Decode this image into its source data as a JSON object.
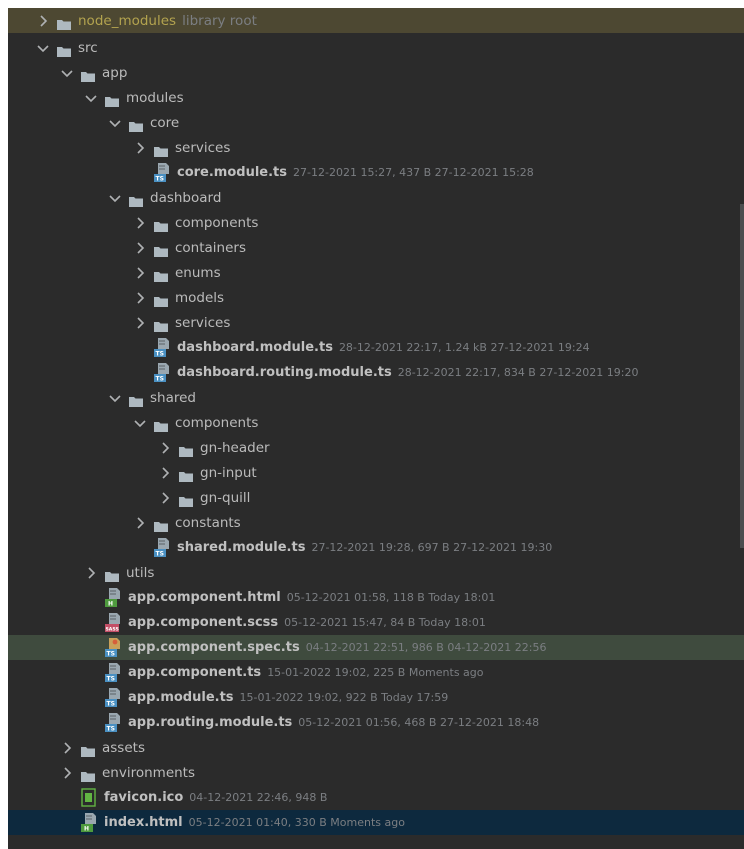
{
  "colors": {
    "background": "#2b2b2b",
    "folder": "#aeb9c0",
    "text": "#bbbbbb",
    "meta_text": "#7b7e82",
    "excluded_text": "#b3a34f",
    "ts_badge": "#4a90c2",
    "html_badge": "#4e9a3e",
    "sass_badge": "#c34e66",
    "selected_row": "#3f4b3e",
    "focused_row": "#0d293e",
    "library_row": "#4d4832"
  },
  "tree": {
    "items": [
      {
        "type": "folder",
        "state": "collapsed",
        "depth": 1,
        "name": "node_modules",
        "meta": "library root",
        "icon": "folder-icon",
        "highlight": "root",
        "style": "yellow"
      },
      {
        "type": "folder",
        "state": "expanded",
        "depth": 1,
        "name": "src",
        "icon": "folder-icon"
      },
      {
        "type": "folder",
        "state": "expanded",
        "depth": 2,
        "name": "app",
        "icon": "folder-icon"
      },
      {
        "type": "folder",
        "state": "expanded",
        "depth": 3,
        "name": "modules",
        "icon": "folder-icon"
      },
      {
        "type": "folder",
        "state": "expanded",
        "depth": 4,
        "name": "core",
        "icon": "folder-icon"
      },
      {
        "type": "folder",
        "state": "collapsed",
        "depth": 5,
        "name": "services",
        "icon": "folder-icon"
      },
      {
        "type": "file",
        "depth": 5,
        "name": "core.module.ts",
        "meta": "27-12-2021 15:27, 437 B 27-12-2021 15:28",
        "icon": "typescript-file-icon"
      },
      {
        "type": "folder",
        "state": "expanded",
        "depth": 4,
        "name": "dashboard",
        "icon": "folder-icon"
      },
      {
        "type": "folder",
        "state": "collapsed",
        "depth": 5,
        "name": "components",
        "icon": "folder-icon"
      },
      {
        "type": "folder",
        "state": "collapsed",
        "depth": 5,
        "name": "containers",
        "icon": "folder-icon"
      },
      {
        "type": "folder",
        "state": "collapsed",
        "depth": 5,
        "name": "enums",
        "icon": "folder-icon"
      },
      {
        "type": "folder",
        "state": "collapsed",
        "depth": 5,
        "name": "models",
        "icon": "folder-icon"
      },
      {
        "type": "folder",
        "state": "collapsed",
        "depth": 5,
        "name": "services",
        "icon": "folder-icon"
      },
      {
        "type": "file",
        "depth": 5,
        "name": "dashboard.module.ts",
        "meta": "28-12-2021 22:17, 1.24 kB 27-12-2021 19:24",
        "icon": "typescript-file-icon"
      },
      {
        "type": "file",
        "depth": 5,
        "name": "dashboard.routing.module.ts",
        "meta": "28-12-2021 22:17, 834 B 27-12-2021 19:20",
        "icon": "typescript-file-icon"
      },
      {
        "type": "folder",
        "state": "expanded",
        "depth": 4,
        "name": "shared",
        "icon": "folder-icon"
      },
      {
        "type": "folder",
        "state": "expanded",
        "depth": 5,
        "name": "components",
        "icon": "folder-icon"
      },
      {
        "type": "folder",
        "state": "collapsed",
        "depth": 6,
        "name": "gn-header",
        "icon": "folder-icon"
      },
      {
        "type": "folder",
        "state": "collapsed",
        "depth": 6,
        "name": "gn-input",
        "icon": "folder-icon"
      },
      {
        "type": "folder",
        "state": "collapsed",
        "depth": 6,
        "name": "gn-quill",
        "icon": "folder-icon"
      },
      {
        "type": "folder",
        "state": "collapsed",
        "depth": 5,
        "name": "constants",
        "icon": "folder-icon"
      },
      {
        "type": "file",
        "depth": 5,
        "name": "shared.module.ts",
        "meta": "27-12-2021 19:28, 697 B 27-12-2021 19:30",
        "icon": "typescript-file-icon"
      },
      {
        "type": "folder",
        "state": "collapsed",
        "depth": 3,
        "name": "utils",
        "icon": "folder-icon"
      },
      {
        "type": "file",
        "depth": 3,
        "name": "app.component.html",
        "meta": "05-12-2021 01:58, 118 B Today 18:01",
        "icon": "html-file-icon"
      },
      {
        "type": "file",
        "depth": 3,
        "name": "app.component.scss",
        "meta": "05-12-2021 15:47, 84 B Today 18:01",
        "icon": "sass-file-icon"
      },
      {
        "type": "file",
        "depth": 3,
        "name": "app.component.spec.ts",
        "meta": "04-12-2021 22:51, 986 B 04-12-2021 22:56",
        "icon": "typescript-test-file-icon",
        "highlight": "selected"
      },
      {
        "type": "file",
        "depth": 3,
        "name": "app.component.ts",
        "meta": "15-01-2022 19:02, 225 B Moments ago",
        "icon": "typescript-file-icon"
      },
      {
        "type": "file",
        "depth": 3,
        "name": "app.module.ts",
        "meta": "15-01-2022 19:02, 922 B Today 17:59",
        "icon": "typescript-file-icon"
      },
      {
        "type": "file",
        "depth": 3,
        "name": "app.routing.module.ts",
        "meta": "05-12-2021 01:56, 468 B 27-12-2021 18:48",
        "icon": "typescript-file-icon"
      },
      {
        "type": "folder",
        "state": "collapsed",
        "depth": 2,
        "name": "assets",
        "icon": "folder-icon"
      },
      {
        "type": "folder",
        "state": "collapsed",
        "depth": 2,
        "name": "environments",
        "icon": "folder-icon"
      },
      {
        "type": "file",
        "depth": 2,
        "name": "favicon.ico",
        "meta": "04-12-2021 22:46, 948 B",
        "icon": "image-file-icon"
      },
      {
        "type": "file",
        "depth": 2,
        "name": "index.html",
        "meta": "05-12-2021 01:40, 330 B Moments ago",
        "icon": "html-file-icon",
        "highlight": "focus"
      }
    ]
  }
}
